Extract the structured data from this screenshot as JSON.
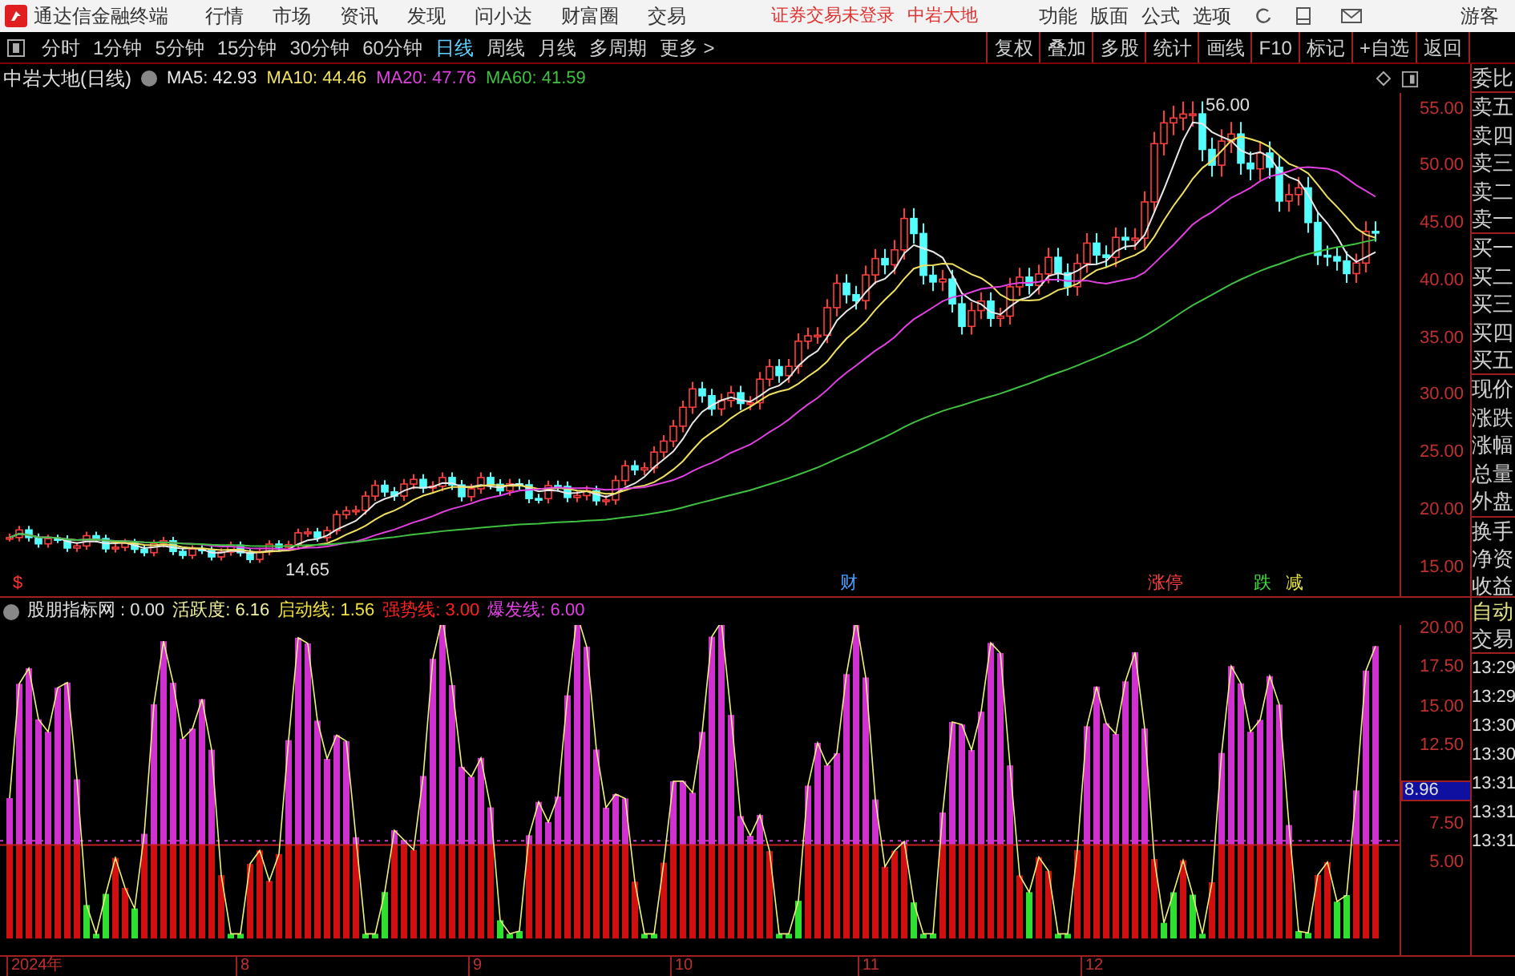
{
  "app": {
    "name": "通达信金融终端"
  },
  "menu": [
    "行情",
    "市场",
    "资讯",
    "发现",
    "问小达",
    "财富圈",
    "交易"
  ],
  "login_status": "证券交易未登录",
  "stock_name": "中岩大地",
  "menu_right": [
    "功能",
    "版面",
    "公式",
    "选项"
  ],
  "user": "游客",
  "periods": [
    {
      "label": "分时",
      "selected": false
    },
    {
      "label": "1分钟",
      "selected": false
    },
    {
      "label": "5分钟",
      "selected": false
    },
    {
      "label": "15分钟",
      "selected": false
    },
    {
      "label": "30分钟",
      "selected": false
    },
    {
      "label": "60分钟",
      "selected": false
    },
    {
      "label": "日线",
      "selected": true
    },
    {
      "label": "周线",
      "selected": false
    },
    {
      "label": "月线",
      "selected": false
    },
    {
      "label": "多周期",
      "selected": false
    },
    {
      "label": "更多 >",
      "selected": false
    }
  ],
  "tools": [
    "复权",
    "叠加",
    "多股",
    "统计",
    "画线",
    "F10",
    "标记",
    "+自选",
    "返回"
  ],
  "chart": {
    "title": "中岩大地(日线)",
    "ma": [
      {
        "label": "MA5: 42.93",
        "color": "#e8e8e8"
      },
      {
        "label": "MA10: 44.46",
        "color": "#f0e060"
      },
      {
        "label": "MA20: 47.76",
        "color": "#e040e0"
      },
      {
        "label": "MA60: 41.59",
        "color": "#40c040"
      }
    ],
    "price_ticks": [
      "55.00",
      "50.00",
      "45.00",
      "40.00",
      "35.00",
      "30.00",
      "25.00",
      "20.00",
      "15.00"
    ],
    "high_label": "56.00",
    "low_label": "14.65",
    "markers": [
      {
        "text": "$",
        "color": "#ff3030"
      },
      {
        "text": "财",
        "color": "#4aa0ff"
      },
      {
        "text": "涨停",
        "color": "#ff4040"
      },
      {
        "text": "跌",
        "color": "#40e040"
      },
      {
        "text": "减",
        "color": "#e0e040"
      }
    ]
  },
  "indicator": {
    "items": [
      {
        "label": "股朋指标网 : 0.00",
        "color": "#e0e0e0"
      },
      {
        "label": "活跃度: 6.16",
        "color": "#f0f0a0"
      },
      {
        "label": "启动线: 1.56",
        "color": "#f0e040"
      },
      {
        "label": "强势线: 3.00",
        "color": "#ff2020"
      },
      {
        "label": "爆发线: 6.00",
        "color": "#e040e0"
      }
    ],
    "ticks": [
      "20.00",
      "17.50",
      "15.00",
      "12.50",
      "7.50",
      "5.00"
    ],
    "current": "8.96"
  },
  "quote_panel": [
    "委比",
    "卖五",
    "卖四",
    "卖三",
    "卖二",
    "卖一",
    "买一",
    "买二",
    "买三",
    "买四",
    "买五",
    "现价",
    "涨跌",
    "涨幅",
    "总量",
    "外盘",
    "换手",
    "净资",
    "收益"
  ],
  "trade_panel": {
    "title": "自动",
    "subtitle": "交易",
    "times": [
      "13:29",
      "13:29",
      "13:30",
      "13:30",
      "13:31",
      "13:31",
      "13:31"
    ]
  },
  "date_axis": [
    "2024年",
    "8",
    "9",
    "10",
    "11",
    "12"
  ]
}
